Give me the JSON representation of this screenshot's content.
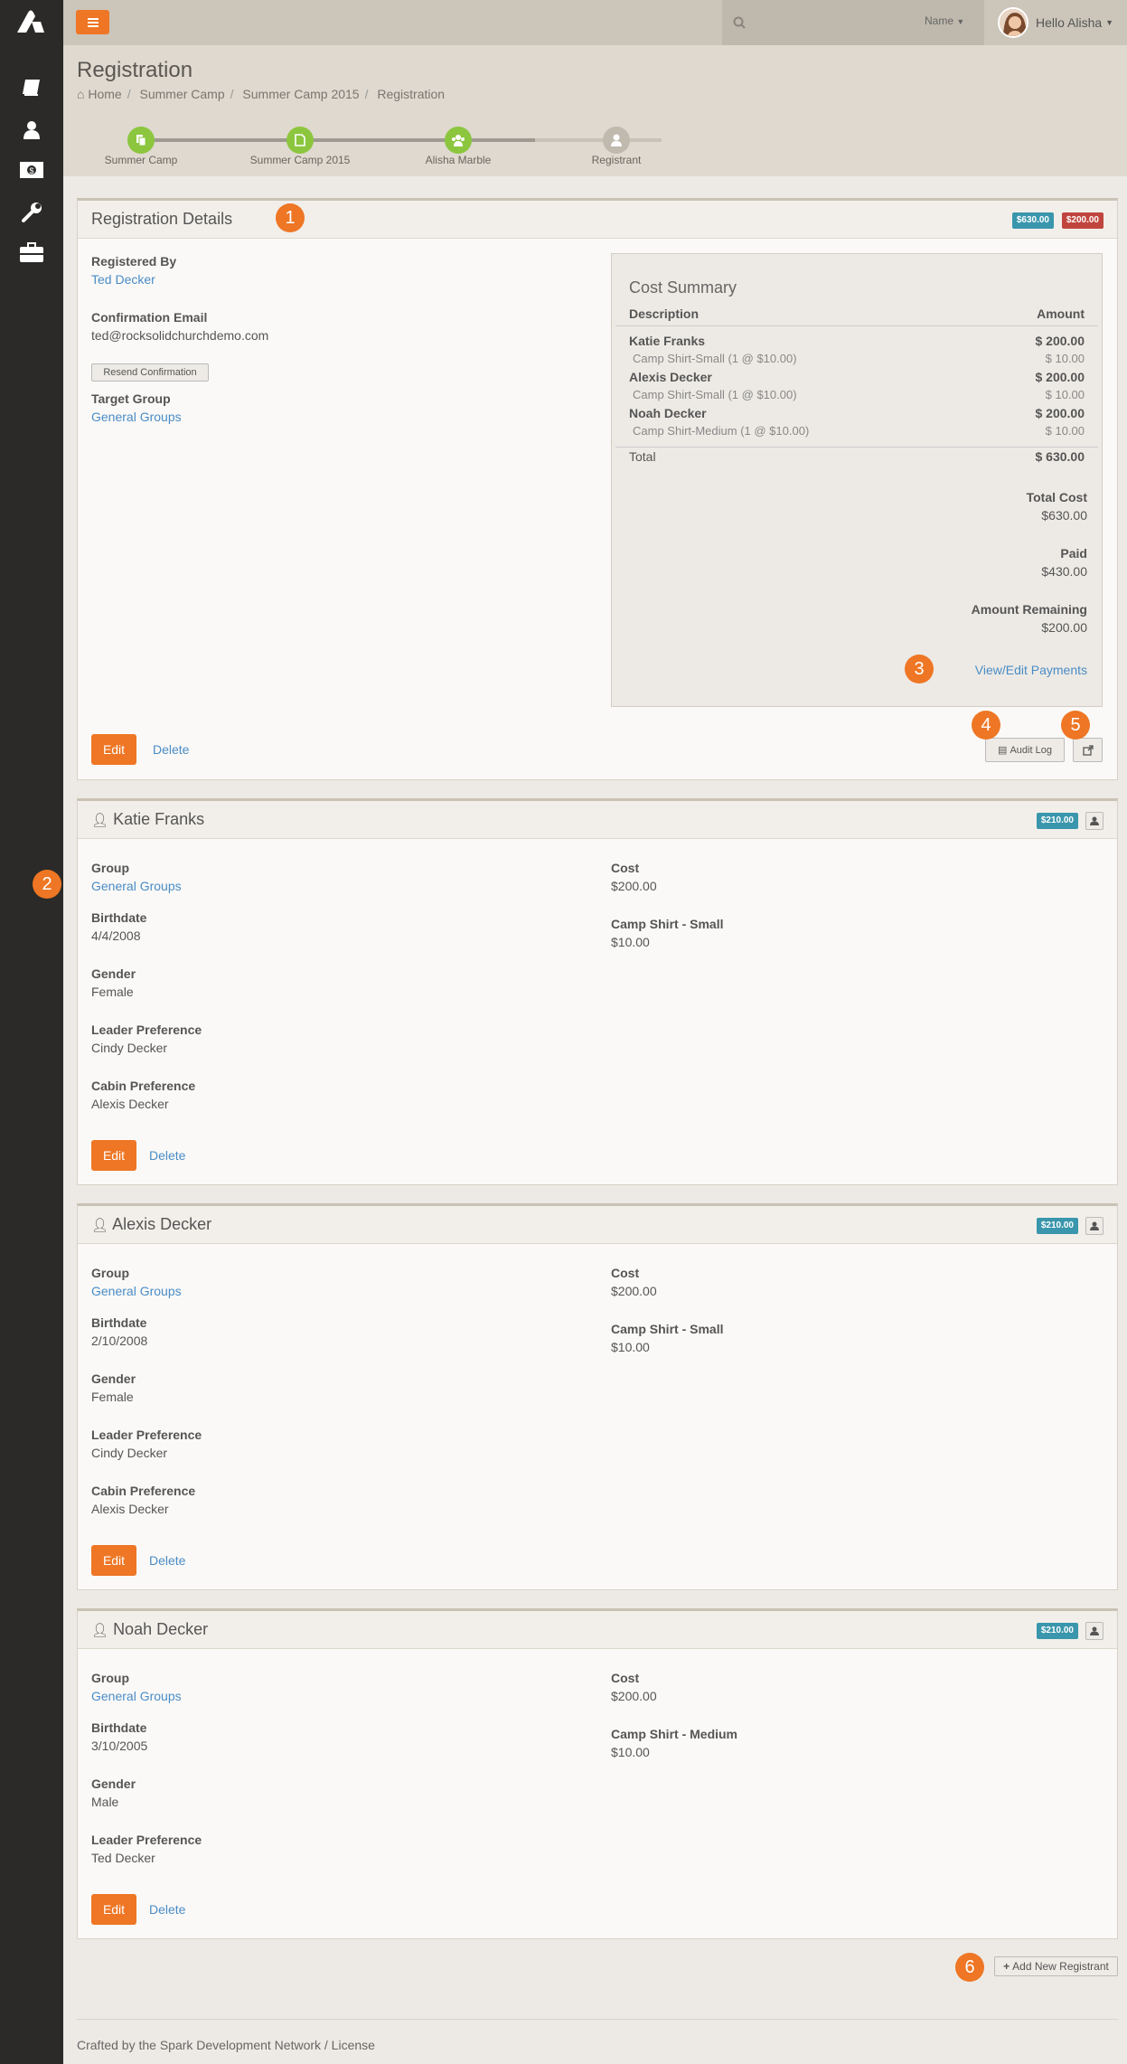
{
  "topbar": {
    "search_type": "Name",
    "greeting": "Hello Alisha"
  },
  "page": {
    "title": "Registration",
    "breadcrumb": [
      "Home",
      "Summer Camp",
      "Summer Camp 2015",
      "Registration"
    ]
  },
  "wizard": {
    "steps": [
      "Summer Camp",
      "Summer Camp 2015",
      "Alisha Marble",
      "Registrant"
    ]
  },
  "registration": {
    "title": "Registration Details",
    "badge_total": "$630.00",
    "badge_due": "$200.00",
    "registered_by_label": "Registered By",
    "registered_by": "Ted Decker",
    "confirmation_label": "Confirmation Email",
    "confirmation_email": "ted@rocksolidchurchdemo.com",
    "resend_label": "Resend Confirmation",
    "target_group_label": "Target Group",
    "target_group": "General Groups",
    "edit_label": "Edit",
    "delete_label": "Delete",
    "audit_log_label": "Audit Log"
  },
  "cost_summary": {
    "title": "Cost Summary",
    "col_description": "Description",
    "col_amount": "Amount",
    "lines": [
      {
        "desc": "Katie Franks",
        "amount": "$ 200.00",
        "sub": false
      },
      {
        "desc": "Camp Shirt-Small (1 @ $10.00)",
        "amount": "$ 10.00",
        "sub": true
      },
      {
        "desc": "Alexis Decker",
        "amount": "$ 200.00",
        "sub": false
      },
      {
        "desc": "Camp Shirt-Small (1 @ $10.00)",
        "amount": "$ 10.00",
        "sub": true
      },
      {
        "desc": "Noah Decker",
        "amount": "$ 200.00",
        "sub": false
      },
      {
        "desc": "Camp Shirt-Medium (1 @ $10.00)",
        "amount": "$ 10.00",
        "sub": true
      }
    ],
    "total_label": "Total",
    "total_amount": "$ 630.00",
    "total_cost_label": "Total Cost",
    "total_cost": "$630.00",
    "paid_label": "Paid",
    "paid": "$430.00",
    "remaining_label": "Amount Remaining",
    "remaining": "$200.00",
    "payments_link": "View/Edit Payments"
  },
  "registrants": [
    {
      "name": "Katie Franks",
      "badge": "$210.00",
      "group_label": "Group",
      "group": "General Groups",
      "birthdate_label": "Birthdate",
      "birthdate": "4/4/2008",
      "gender_label": "Gender",
      "gender": "Female",
      "leader_label": "Leader Preference",
      "leader": "Cindy Decker",
      "cabin_label": "Cabin Preference",
      "cabin": "Alexis Decker",
      "cost_label": "Cost",
      "cost": "$200.00",
      "shirt_label": "Camp Shirt - Small",
      "shirt": "$10.00",
      "edit_label": "Edit",
      "delete_label": "Delete"
    },
    {
      "name": "Alexis Decker",
      "badge": "$210.00",
      "group_label": "Group",
      "group": "General Groups",
      "birthdate_label": "Birthdate",
      "birthdate": "2/10/2008",
      "gender_label": "Gender",
      "gender": "Female",
      "leader_label": "Leader Preference",
      "leader": "Cindy Decker",
      "cabin_label": "Cabin Preference",
      "cabin": "Alexis Decker",
      "cost_label": "Cost",
      "cost": "$200.00",
      "shirt_label": "Camp Shirt - Small",
      "shirt": "$10.00",
      "edit_label": "Edit",
      "delete_label": "Delete"
    },
    {
      "name": "Noah Decker",
      "badge": "$210.00",
      "group_label": "Group",
      "group": "General Groups",
      "birthdate_label": "Birthdate",
      "birthdate": "3/10/2005",
      "gender_label": "Gender",
      "gender": "Male",
      "leader_label": "Leader Preference",
      "leader": "Ted Decker",
      "cost_label": "Cost",
      "cost": "$200.00",
      "shirt_label": "Camp Shirt - Medium",
      "shirt": "$10.00",
      "edit_label": "Edit",
      "delete_label": "Delete"
    }
  ],
  "add_registrant_label": "Add New Registrant",
  "callouts": [
    "1",
    "2",
    "3",
    "4",
    "5",
    "6"
  ],
  "footer": "Crafted by the Spark Development Network / License",
  "colors": {
    "accent": "#ee7624",
    "badge_info": "#3a96ac",
    "badge_danger": "#c0453e",
    "wizard_done": "#8cc63f"
  }
}
